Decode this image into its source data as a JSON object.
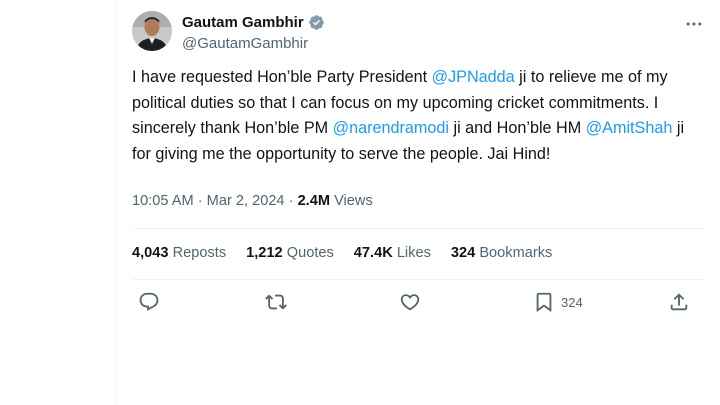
{
  "tweet": {
    "author": {
      "display_name": "Gautam Gambhir",
      "handle": "@GautamGambhir",
      "verified": true
    },
    "text_segments": [
      {
        "text": "I have requested Hon’ble Party President ",
        "type": "text"
      },
      {
        "text": "@JPNadda",
        "type": "mention"
      },
      {
        "text": " ji to relieve me of my political duties so that I can focus on my upcoming cricket commitments. I sincerely thank Hon’ble PM ",
        "type": "text"
      },
      {
        "text": "@narendramodi",
        "type": "mention"
      },
      {
        "text": " ji and Hon’ble HM ",
        "type": "text"
      },
      {
        "text": "@AmitShah",
        "type": "mention"
      },
      {
        "text": " ji for giving me the opportunity to serve the people. Jai Hind!",
        "type": "text"
      }
    ],
    "meta": {
      "time": "10:05 AM",
      "separator": "·",
      "date": "Mar 2, 2024",
      "views_count": "2.4M",
      "views_label": "Views"
    },
    "stats": {
      "reposts_count": "4,043",
      "reposts_label": "Reposts",
      "quotes_count": "1,212",
      "quotes_label": "Quotes",
      "likes_count": "47.4K",
      "likes_label": "Likes",
      "bookmarks_count": "324",
      "bookmarks_label": "Bookmarks"
    },
    "actions": {
      "reply_icon": "reply-icon",
      "repost_icon": "repost-icon",
      "like_icon": "like-icon",
      "bookmark_icon": "bookmark-icon",
      "bookmark_count": "324",
      "share_icon": "share-icon"
    },
    "colors": {
      "link": "#1d9bf0",
      "secondary_text": "#536471",
      "primary_text": "#0f1419",
      "verified_badge": "#829aab"
    }
  }
}
